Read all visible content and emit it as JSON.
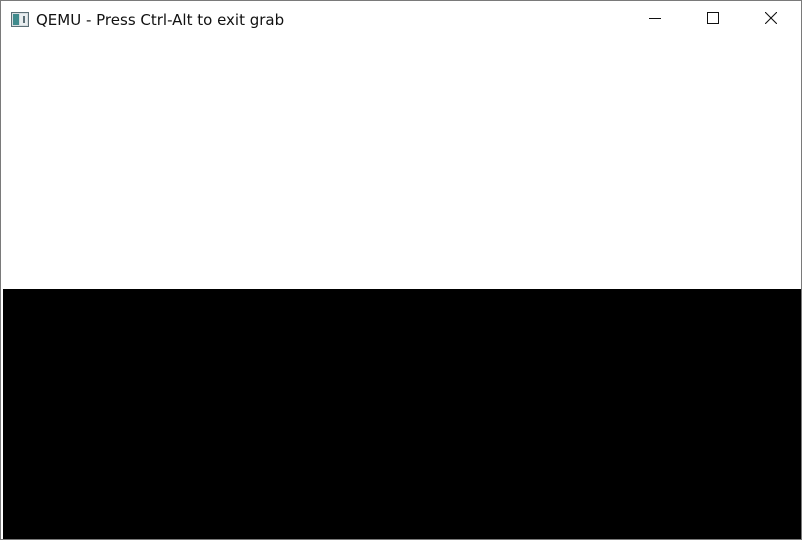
{
  "window": {
    "title": "QEMU - Press Ctrl-Alt to exit grab",
    "app_icon": "qemu-monitor-icon",
    "controls": {
      "minimize_icon": "minimize-icon",
      "maximize_icon": "maximize-icon",
      "close_icon": "close-icon"
    }
  },
  "guest_display": {
    "upper_color": "#ffffff",
    "lower_color": "#000000"
  }
}
